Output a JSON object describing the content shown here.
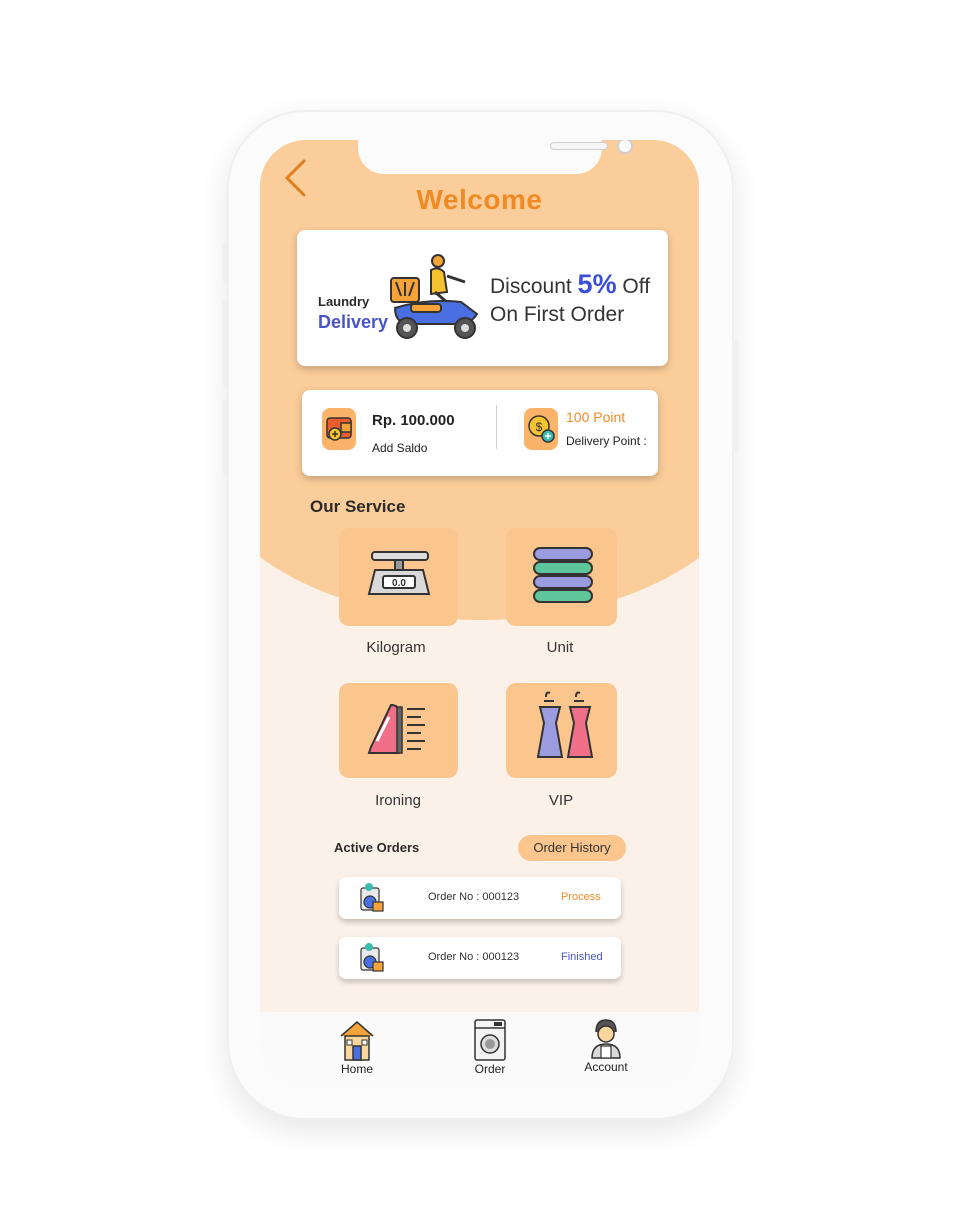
{
  "header": {
    "title": "Welcome"
  },
  "banner": {
    "brand_line1": "Laundry",
    "brand_line2": "Delivery",
    "promo_prefix": "Discount",
    "promo_percent": "5%",
    "promo_suffix": "Off",
    "promo_line2": "On First Order"
  },
  "wallet": {
    "balance": "Rp. 100.000",
    "add_label": "Add Saldo",
    "points": "100 Point",
    "points_label": "Delivery Point :"
  },
  "services": {
    "title": "Our  Service",
    "items": [
      {
        "label": "Kilogram",
        "icon": "scale-icon"
      },
      {
        "label": "Unit",
        "icon": "folded-clothes-icon"
      },
      {
        "label": "Ironing",
        "icon": "iron-icon"
      },
      {
        "label": "VIP",
        "icon": "dresses-icon"
      }
    ],
    "scale_reading": "0.0"
  },
  "orders": {
    "title": "Active Orders",
    "history_label": "Order History",
    "items": [
      {
        "number": "Order No : 000123",
        "status": "Process",
        "status_color": "#f08a24"
      },
      {
        "number": "Order No : 000123",
        "status": "Finished",
        "status_color": "#4a54c9"
      }
    ]
  },
  "nav": {
    "items": [
      {
        "label": "Home",
        "icon": "house-icon"
      },
      {
        "label": "Order",
        "icon": "washing-machine-icon"
      },
      {
        "label": "Account",
        "icon": "worker-avatar-icon"
      }
    ]
  },
  "colors": {
    "accent": "#f08a24",
    "header_bg": "#fbcd9a",
    "screen_bg": "#fcf1e9",
    "blue": "#4a54c9"
  }
}
